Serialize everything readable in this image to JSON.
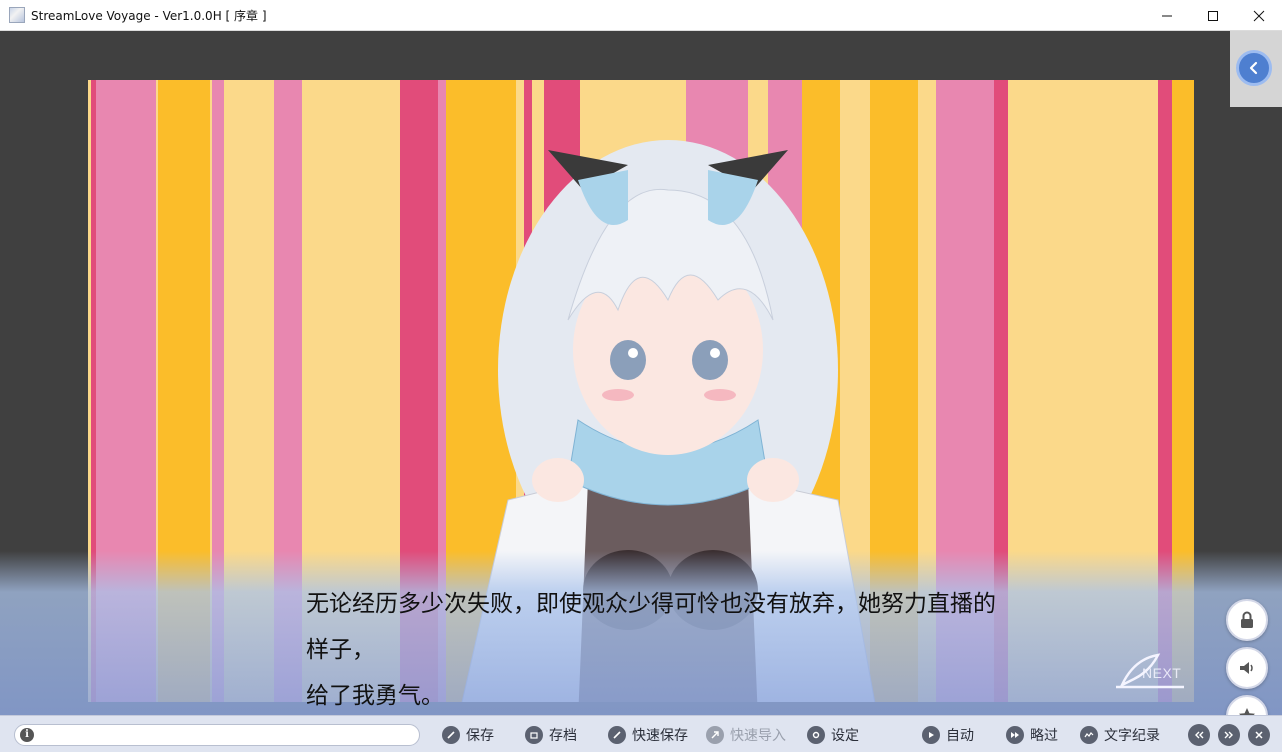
{
  "window": {
    "title": "StreamLove Voyage - Ver1.0.0H [ 序章 ]"
  },
  "dialogue": {
    "lines": [
      "无论经历多少次失败，即使观众少得可怜也没有放弃，她努力直播的",
      "样子，",
      "给了我勇气。"
    ],
    "next_label": "NEXT"
  },
  "side_buttons": [
    "lock-icon",
    "speaker-icon",
    "star-icon"
  ],
  "toolbar": {
    "message_value": "",
    "save": "保存",
    "archive": "存档",
    "quick_save": "快速保存",
    "quick_load": "快速导入",
    "settings": "设定",
    "auto": "自动",
    "skip": "略过",
    "log": "文字纪录"
  },
  "colors": {
    "stripe_pink": "#e887b0",
    "stripe_rose": "#e14c7a",
    "stripe_yellow": "#fbbd2a",
    "stripe_cream": "#fbd98a",
    "accent_blue": "#4e7fd0",
    "toolbar_bg": "#dfe4f0"
  }
}
